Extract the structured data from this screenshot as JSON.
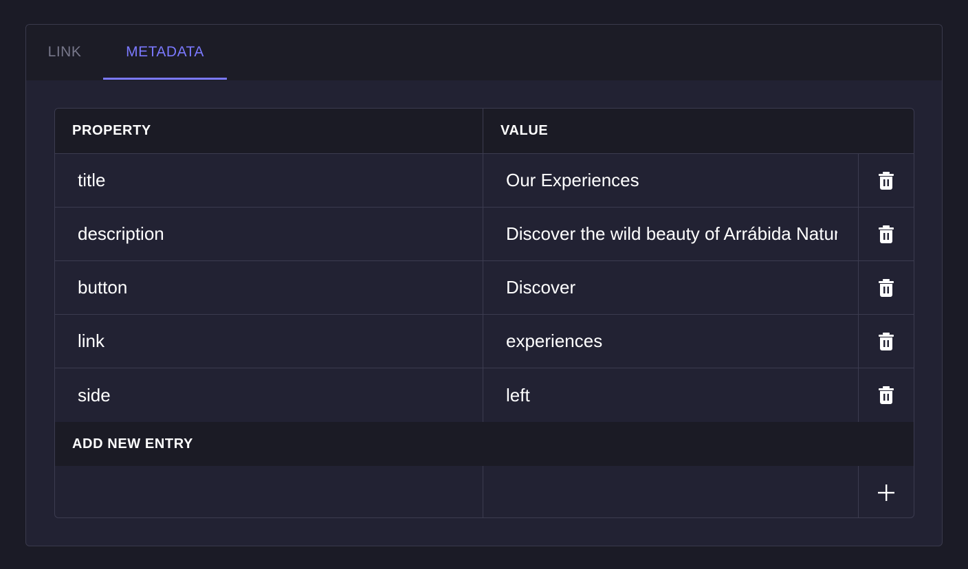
{
  "tabs": [
    {
      "label": "LINK",
      "active": false
    },
    {
      "label": "METADATA",
      "active": true
    }
  ],
  "table": {
    "headers": {
      "property": "PROPERTY",
      "value": "VALUE"
    },
    "rows": [
      {
        "property": "title",
        "value": "Our Experiences"
      },
      {
        "property": "description",
        "value": "Discover the wild beauty of Arrábida Natural Park"
      },
      {
        "property": "button",
        "value": "Discover"
      },
      {
        "property": "link",
        "value": "experiences"
      },
      {
        "property": "side",
        "value": "left"
      }
    ],
    "row_action_icon": "trash-icon"
  },
  "add_entry": {
    "header": "ADD NEW ENTRY",
    "property_value": "",
    "value_value": "",
    "action_icon": "plus-icon"
  },
  "colors": {
    "accent": "#7b79ff",
    "background": "#1b1b26",
    "panel": "#222233",
    "header_bg": "#1b1b25"
  }
}
